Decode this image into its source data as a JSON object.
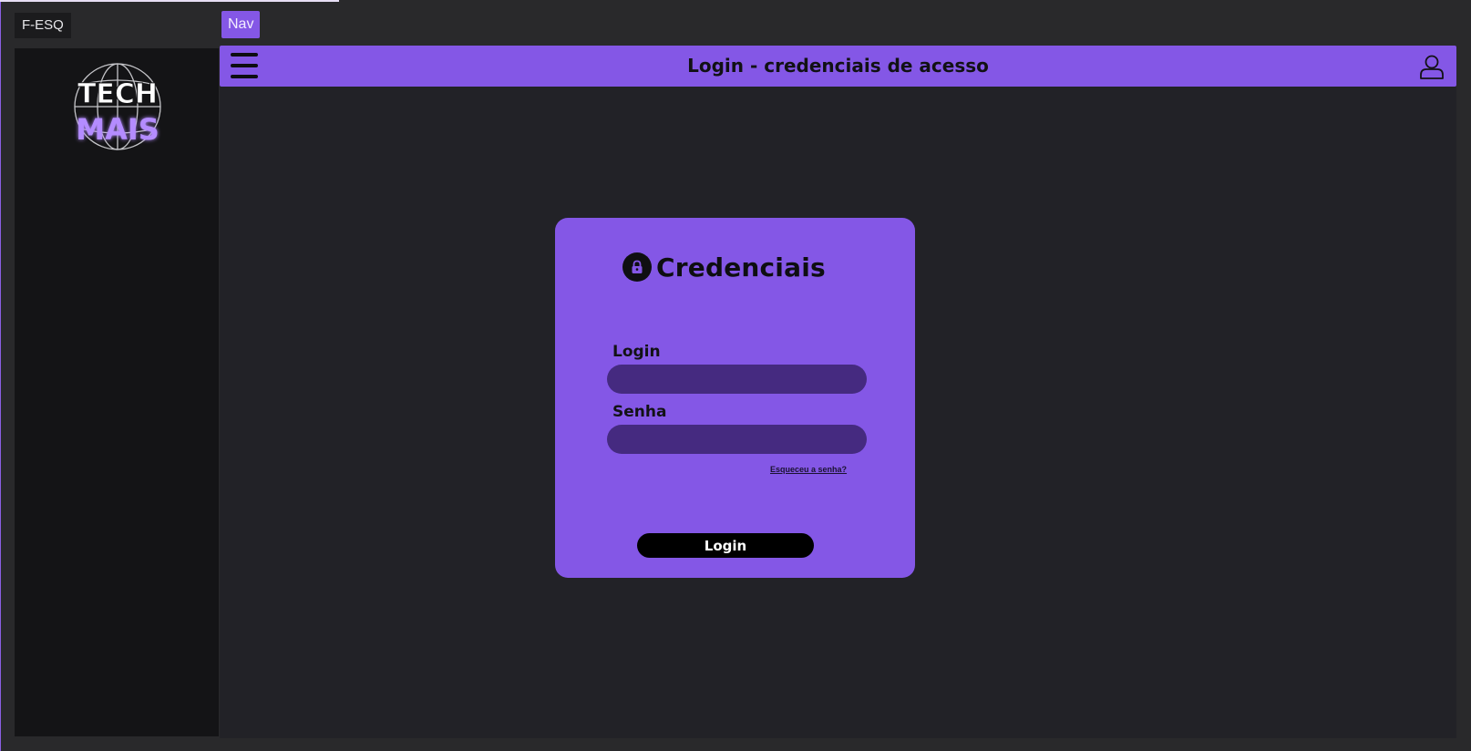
{
  "tags": {
    "sidebar_tag": "F-ESQ",
    "nav_tag": "Nav"
  },
  "sidebar": {
    "logo": {
      "line1": "TECH",
      "line2": "MAIS",
      "accent": "#b48cff"
    }
  },
  "navbar": {
    "title": "Login - credenciais de acesso",
    "left_icon": "menu-icon",
    "right_icon": "user-icon",
    "color": "#8457e6"
  },
  "card": {
    "icon": "lock-icon",
    "title": "Credenciais",
    "login_label": "Login",
    "login_value": "",
    "password_label": "Senha",
    "password_value": "",
    "forgot_link": "Esqueceu a senha?",
    "submit_label": "Login",
    "color": "#8457e6",
    "input_color": "#452a80"
  }
}
